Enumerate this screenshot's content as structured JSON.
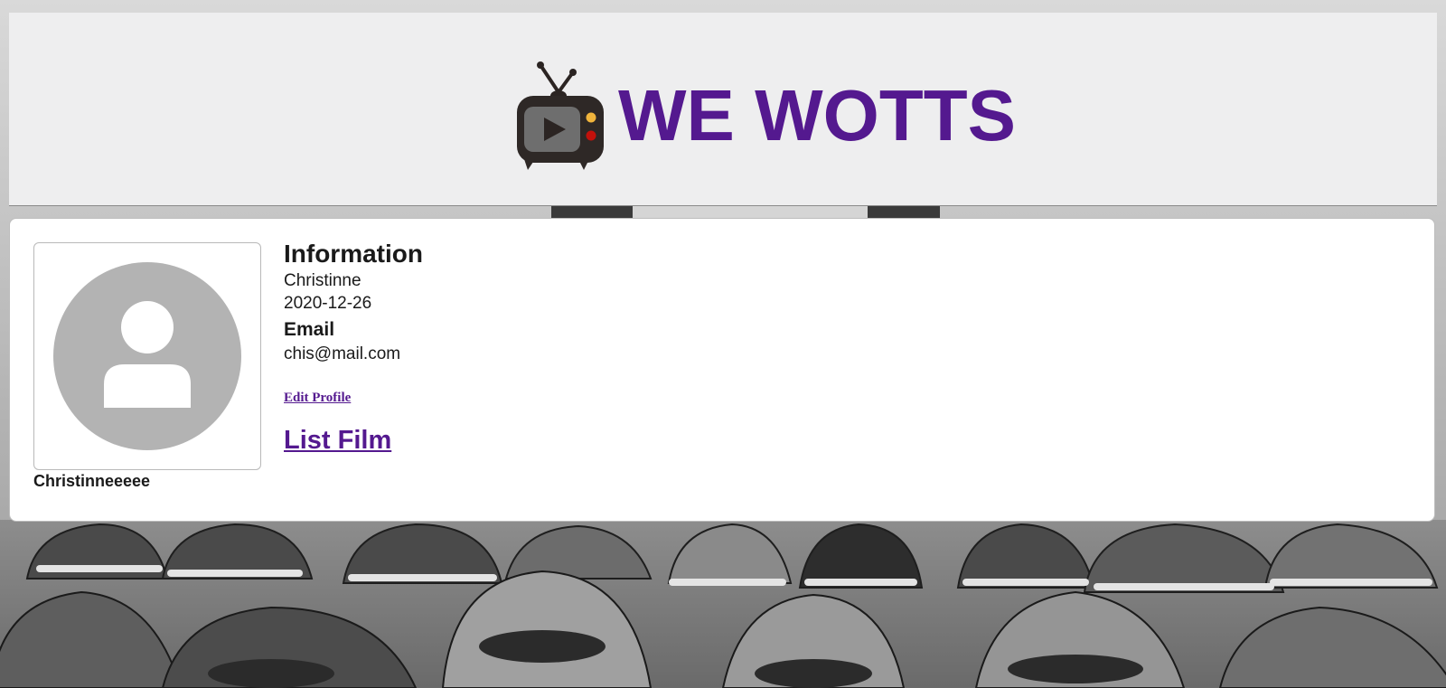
{
  "header": {
    "brand": "WE WOTTS",
    "logo_icon": "tv-play-icon",
    "brand_color": "#54198f"
  },
  "profile": {
    "avatar_icon": "default-user-avatar-icon",
    "username": "Christinneeeee",
    "information_heading": "Information",
    "name": "Christinne",
    "date": "2020-12-26",
    "email_heading": "Email",
    "email": "chis@mail.com",
    "edit_profile_label": "Edit Profile",
    "list_film_label": "List Film"
  },
  "background": {
    "description_icon": "drive-in-cars-photo"
  }
}
